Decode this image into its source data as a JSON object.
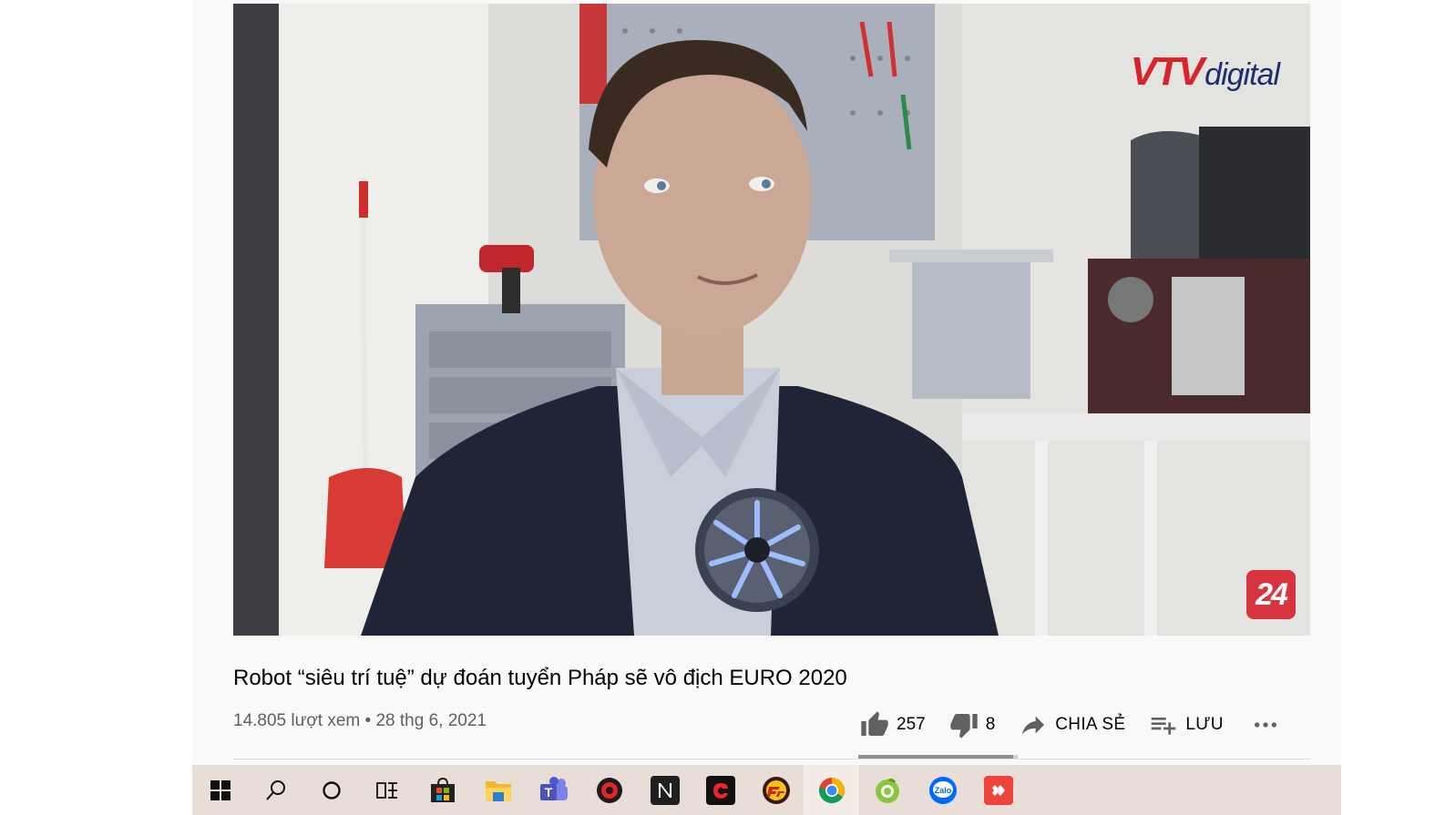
{
  "video": {
    "title": "Robot “siêu trí tuệ” dự đoán tuyển Pháp sẽ vô địch EURO 2020",
    "views": "14.805 lượt xem",
    "separator": "•",
    "date": "28 thg 6, 2021",
    "watermark_brand": "VTV",
    "watermark_suffix": "digital",
    "channel_badge": "24"
  },
  "actions": {
    "like_count": "257",
    "dislike_count": "8",
    "share_label": "CHIA SẺ",
    "save_label": "LƯU",
    "like_ratio": 0.97
  },
  "taskbar": {
    "items": [
      {
        "name": "windows-start-icon"
      },
      {
        "name": "search-icon"
      },
      {
        "name": "cortana-icon"
      },
      {
        "name": "task-view-icon"
      },
      {
        "name": "microsoft-store-icon"
      },
      {
        "name": "file-explorer-icon"
      },
      {
        "name": "teams-icon"
      },
      {
        "name": "game-app-icon"
      },
      {
        "name": "notion-icon"
      },
      {
        "name": "garena-icon"
      },
      {
        "name": "crossfire-icon"
      },
      {
        "name": "chrome-icon"
      },
      {
        "name": "coccoc-icon"
      },
      {
        "name": "zalo-icon"
      },
      {
        "name": "anydesk-icon"
      }
    ],
    "zalo_text": "Zalo"
  },
  "colors": {
    "brand_red": "#d9232b",
    "brand_blue": "#1e2d6b",
    "badge_red": "#d8343f",
    "taskbar_bg": "#e8ded7",
    "page_bg": "#f9f9f9"
  }
}
